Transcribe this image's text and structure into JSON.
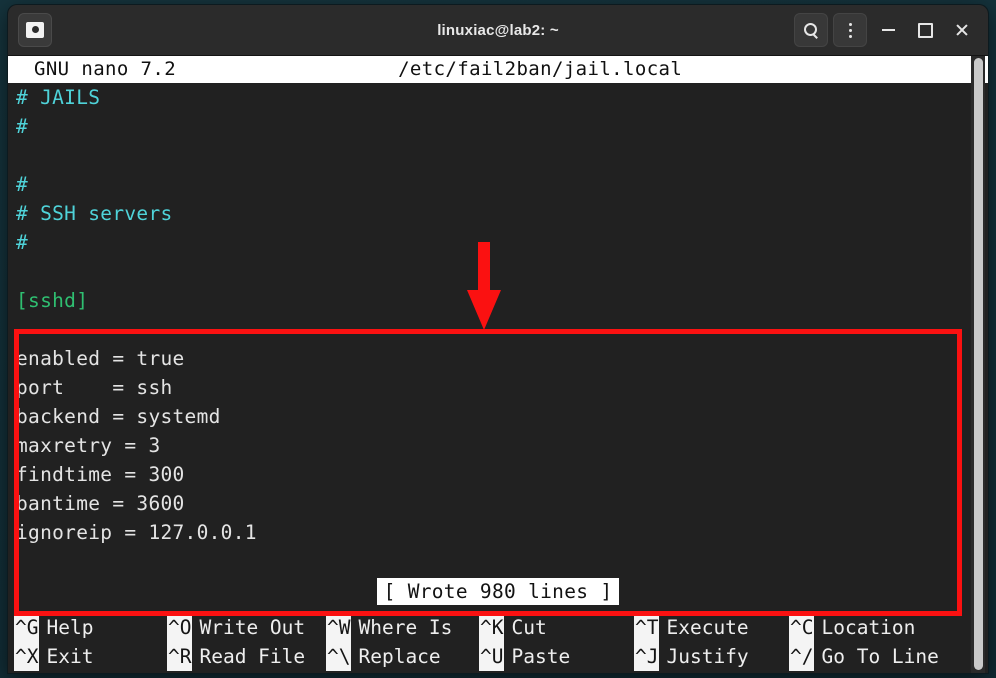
{
  "window": {
    "title": "linuxiac@lab2: ~",
    "app_icon": "terminal-icon",
    "buttons": {
      "search": "search-icon",
      "menu": "kebab-menu-icon",
      "minimize": "minimize-icon",
      "maximize": "maximize-icon",
      "close": "close-icon"
    }
  },
  "nano": {
    "version_label": "GNU nano 7.2",
    "file_path": "/etc/fail2ban/jail.local",
    "status_message": "[ Wrote 980 lines ]",
    "editor_lines": [
      {
        "text": "# JAILS",
        "type": "comment"
      },
      {
        "text": "#",
        "type": "comment"
      },
      {
        "text": "",
        "type": "plain"
      },
      {
        "text": "#",
        "type": "comment"
      },
      {
        "text": "# SSH servers",
        "type": "comment"
      },
      {
        "text": "#",
        "type": "comment"
      },
      {
        "text": "",
        "type": "plain"
      },
      {
        "text": "[sshd]",
        "type": "section"
      },
      {
        "text": "",
        "type": "plain"
      },
      {
        "text": "enabled = true",
        "type": "plain"
      },
      {
        "text": "port    = ssh",
        "type": "plain"
      },
      {
        "text": "backend = systemd",
        "type": "plain"
      },
      {
        "text": "maxretry = 3",
        "type": "plain"
      },
      {
        "text": "findtime = 300",
        "type": "plain"
      },
      {
        "text": "bantime = 3600",
        "type": "plain"
      },
      {
        "text": "ignoreip = 127.0.0.1",
        "type": "plain"
      }
    ],
    "shortcuts_row1": [
      {
        "key": "^G",
        "label": "Help"
      },
      {
        "key": "^O",
        "label": "Write Out"
      },
      {
        "key": "^W",
        "label": "Where Is"
      },
      {
        "key": "^K",
        "label": "Cut"
      },
      {
        "key": "^T",
        "label": "Execute"
      },
      {
        "key": "^C",
        "label": "Location"
      }
    ],
    "shortcuts_row2": [
      {
        "key": "^X",
        "label": "Exit"
      },
      {
        "key": "^R",
        "label": "Read File"
      },
      {
        "key": "^\\",
        "label": "Replace"
      },
      {
        "key": "^U",
        "label": "Paste"
      },
      {
        "key": "^J",
        "label": "Justify"
      },
      {
        "key": "^/",
        "label": "Go To Line"
      }
    ]
  },
  "annotations": {
    "highlight_color": "#fb1111",
    "arrow_color": "#fb1111",
    "arrow_direction": "down",
    "highlight_target": "sshd-jail-block"
  },
  "colors": {
    "terminal_background": "#212121",
    "comment_text": "#4fd3d9",
    "section_text": "#2fbf71",
    "body_text": "#e4e4e4",
    "titlebar": "#2b2b2b",
    "desktop": "#15333c"
  }
}
